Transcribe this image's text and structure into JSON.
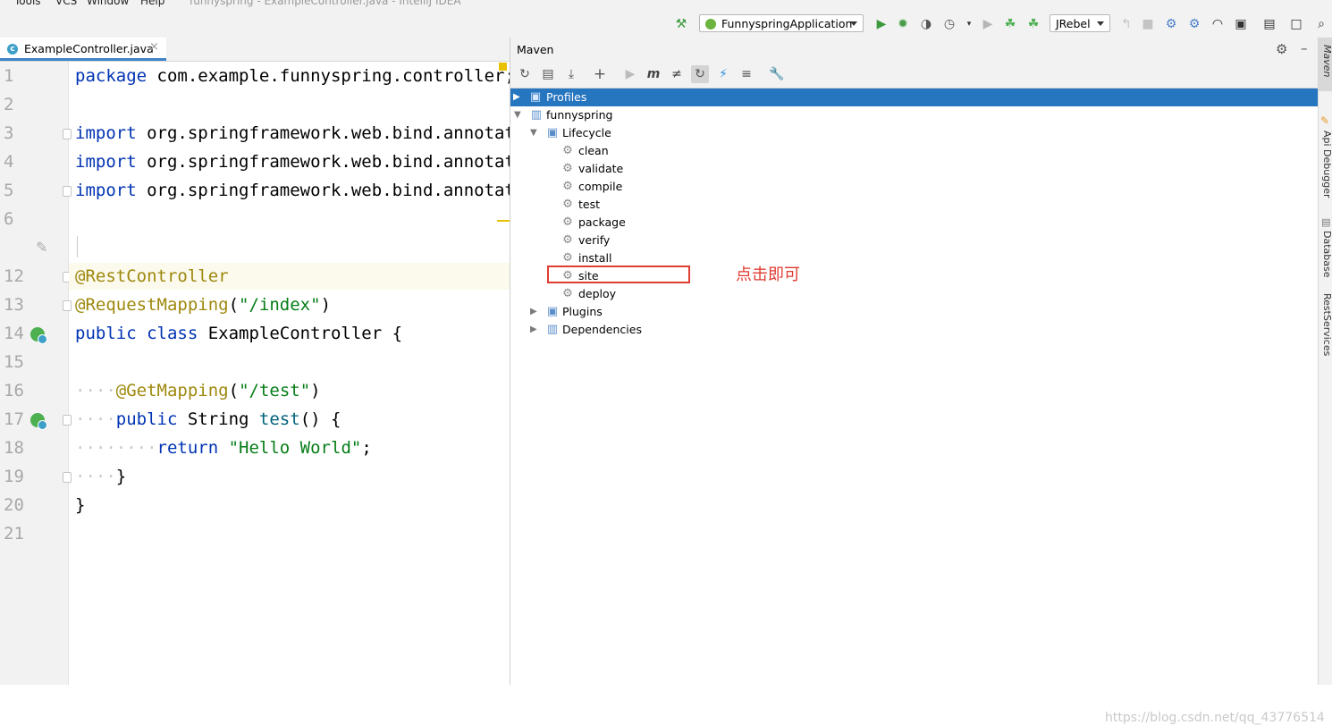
{
  "menubar": {
    "tools": "Tools",
    "vcs": "VCS",
    "window": "Window",
    "help": "Help",
    "title": "funnyspring - ExampleController.java - IntelliJ IDEA"
  },
  "toolbar": {
    "run_config": "FunnyspringApplication",
    "jrebel": "JRebel",
    "icons": [
      "build-hammer",
      "run",
      "debug",
      "coverage",
      "profile",
      "jrebel-run",
      "jrebel-debug",
      "wifi",
      "sdk",
      "search"
    ]
  },
  "editor": {
    "tab_label": "ExampleController.java",
    "tab_close": "×",
    "lines": [
      {
        "n": "1",
        "text": "package com.example.funnyspring.controller;"
      },
      {
        "n": "2",
        "text": ""
      },
      {
        "n": "3",
        "text": "import org.springframework.web.bind.annotation.GetMapping;"
      },
      {
        "n": "4",
        "text": "import org.springframework.web.bind.annotation.RequestMapping;"
      },
      {
        "n": "5",
        "text": "import org.springframework.web.bind.annotation.RestController;"
      },
      {
        "n": "6",
        "text": ""
      },
      {
        "n": "12",
        "text": "@RestController"
      },
      {
        "n": "13",
        "text": "@RequestMapping(\"/index\")"
      },
      {
        "n": "14",
        "text": "public class ExampleController {"
      },
      {
        "n": "15",
        "text": ""
      },
      {
        "n": "16",
        "text": "@GetMapping(\"/test\")"
      },
      {
        "n": "17",
        "text": "public String test() {"
      },
      {
        "n": "18",
        "text": "return \"Hello World\";"
      },
      {
        "n": "19",
        "text": "}"
      },
      {
        "n": "20",
        "text": "}"
      },
      {
        "n": "21",
        "text": ""
      }
    ]
  },
  "maven": {
    "title": "Maven",
    "toolbar_icons": [
      "reload",
      "add-project",
      "download",
      "plus",
      "run",
      "execute-goal",
      "toggle-offline",
      "skip-tests",
      "show-deps",
      "collapse",
      "settings-wrench"
    ],
    "tree": {
      "profiles": "Profiles",
      "project": "funnyspring",
      "lifecycle": "Lifecycle",
      "goals": [
        "clean",
        "validate",
        "compile",
        "test",
        "package",
        "verify",
        "install",
        "site",
        "deploy"
      ],
      "plugins": "Plugins",
      "dependencies": "Dependencies"
    },
    "highlighted_goal": "package",
    "annotation": "点击即可",
    "watermark": "https://blog.csdn.net/qq_43776514"
  },
  "right_strip": [
    "Maven",
    "Api Debugger",
    "Database",
    "RestServices"
  ],
  "colors": {
    "selection": "#2675bf",
    "highlight_box": "#e03c31",
    "keyword": "#0033b3",
    "annotation": "#9e880d",
    "string": "#067d17"
  }
}
